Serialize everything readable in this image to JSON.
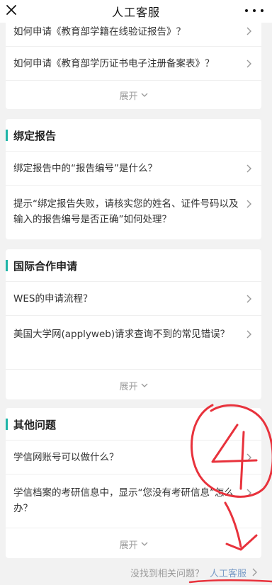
{
  "header": {
    "title": "人工客服"
  },
  "card1": {
    "rows": [
      {
        "label": "如何申请《教育部学籍在线验证报告》？"
      },
      {
        "label": "如何申请《教育部学历证书电子注册备案表》？"
      }
    ],
    "expand_label": "展开"
  },
  "card2": {
    "title": "绑定报告",
    "rows": [
      {
        "label": "绑定报告中的“报告编号”是什么？"
      },
      {
        "label": "提示“绑定报告失败，请核实您的姓名、证件号码以及输入的报告编号是否正确”如何处理？"
      }
    ]
  },
  "card3": {
    "title": "国际合作申请",
    "rows": [
      {
        "label": "WES的申请流程？"
      },
      {
        "label": "美国大学网(applyweb)请求查询不到的常见错误？"
      }
    ],
    "expand_label": "展开"
  },
  "card4": {
    "title": "其他问题",
    "rows": [
      {
        "label": "学信网账号可以做什么？"
      },
      {
        "label": "学信档案的考研信息中，显示“您没有考研信息”怎么办？"
      }
    ],
    "expand_label": "展开"
  },
  "footer": {
    "question": "没找到相关问题？",
    "link": "人工客服"
  },
  "annotation": {
    "mark": "4",
    "color": "#e8323c"
  },
  "colors": {
    "accent": "#1fb5a8",
    "link": "#7a9cc7"
  }
}
